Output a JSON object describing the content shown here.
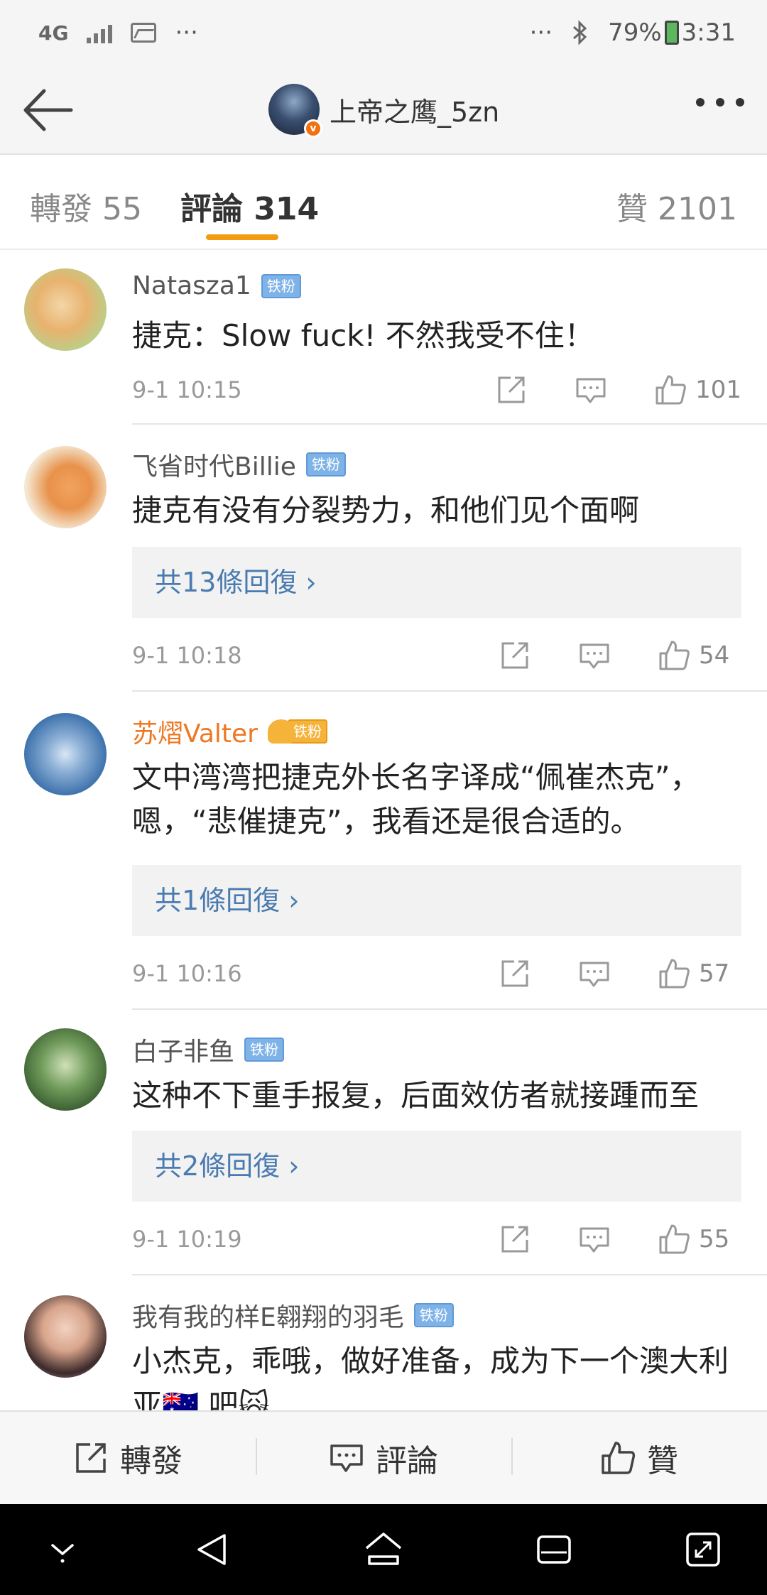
{
  "status_bar": {
    "network": "4G",
    "more": "···",
    "right_more": "···",
    "battery": "79%",
    "time": "3:31"
  },
  "nav": {
    "username": "上帝之鹰_5zn",
    "verified_badge": "v"
  },
  "tabs": {
    "repost": "轉發 55",
    "comments": "評論 314",
    "likes": "贊 2101"
  },
  "comments": [
    {
      "name": "Natasza1",
      "badge": "铁粉",
      "text": "捷克：Slow fuck! 不然我受不住！",
      "replies": "",
      "time": "9-1 10:15",
      "likes": "101"
    },
    {
      "name": "飞省时代Billie",
      "badge": "铁粉",
      "text": "捷克有没有分裂势力，和他们见个面啊",
      "replies": "共13條回復 ›",
      "time": "9-1 10:18",
      "likes": "54"
    },
    {
      "name": "苏熠Valter",
      "badge": "铁粉",
      "text": "文中湾湾把捷克外长名字译成“佩崔杰克”，嗯，“悲催捷克”，我看还是很合适的。",
      "replies": "共1條回復 ›",
      "time": "9-1 10:16",
      "likes": "57"
    },
    {
      "name": "白子非鱼",
      "badge": "铁粉",
      "text": "这种不下重手报复，后面效仿者就接踵而至",
      "replies": "共2條回復 ›",
      "time": "9-1 10:19",
      "likes": "55"
    },
    {
      "name": "我有我的样E翱翔的羽毛",
      "badge": "铁粉",
      "text": "小杰克，乖哦，做好准备，成为下一个澳大利亚🇦🇺 吧🙀",
      "replies": "",
      "time": "",
      "likes": ""
    }
  ],
  "bottom_bar": {
    "repost": "轉發",
    "comment": "評論",
    "like": "贊"
  },
  "colors": {
    "accent": "#f39c12",
    "link": "#4a7bb0",
    "vip_name": "#ee7722",
    "fan_badge": "#7fb3e8"
  }
}
